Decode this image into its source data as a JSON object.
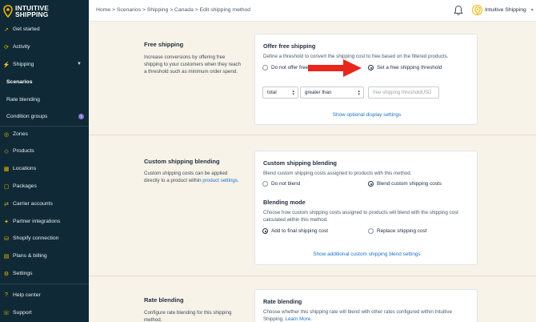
{
  "app": {
    "logo_line1": "INTUITIVE",
    "logo_line2": "SHIPPING"
  },
  "sidebar": {
    "items": [
      {
        "label": "Get started",
        "icon": "rocket-icon"
      },
      {
        "label": "Activity",
        "icon": "activity-icon"
      },
      {
        "label": "Shipping",
        "icon": "shipping-icon"
      },
      {
        "label": "Scenarios"
      },
      {
        "label": "Rate blending"
      },
      {
        "label": "Condition groups",
        "badge": "i"
      },
      {
        "label": "Zones",
        "icon": "zones-icon"
      },
      {
        "label": "Products",
        "icon": "products-icon"
      },
      {
        "label": "Locations",
        "icon": "locations-icon"
      },
      {
        "label": "Packages",
        "icon": "packages-icon"
      },
      {
        "label": "Carrier accounts",
        "icon": "carrier-icon"
      },
      {
        "label": "Partner integrations",
        "icon": "partner-icon"
      },
      {
        "label": "Shopify connection",
        "icon": "shopify-icon"
      },
      {
        "label": "Plans & billing",
        "icon": "billing-icon"
      },
      {
        "label": "Settings",
        "icon": "gear-icon"
      },
      {
        "label": "Help center",
        "icon": "help-icon"
      },
      {
        "label": "Support",
        "icon": "support-icon"
      }
    ]
  },
  "topbar": {
    "breadcrumb": "Home > Scenarios > Shipping > Canada > Edit shipping method",
    "user_name": "Intuitive Shipping"
  },
  "free_shipping": {
    "section_title": "Free shipping",
    "section_desc": "Increase conversions by offering free shipping to your customers when they reach a threshold such as minimum order spend.",
    "card_title": "Offer free shipping",
    "card_text": "Define a threshold to convert the shipping cost to free based on the filtered products.",
    "option_no": "Do not offer free",
    "option_yes": "Set a free shipping threshold",
    "select_1": "total",
    "select_2": "greater than",
    "threshold_placeholder": "free shipping threshold",
    "threshold_unit": "USD",
    "link": "Show optional display settings"
  },
  "custom_blending": {
    "section_title": "Custom shipping blending",
    "section_desc_1": "Custom shipping costs can be applied directly to a product within ",
    "section_desc_link": "product settings",
    "section_desc_2": ".",
    "card_title": "Custom shipping blending",
    "card_text": "Blend custom shipping costs assigned to products with this method.",
    "option_no": "Do not blend",
    "option_yes": "Blend custom shipping costs",
    "mode_title": "Blending mode",
    "mode_text": "Choose how custom shipping costs assigned to products will blend with the shipping cost calculated within this method.",
    "mode_add": "Add to final shipping cost",
    "mode_replace": "Replace shipping cost",
    "link": "Show additional custom shipping blend settings"
  },
  "rate_blending": {
    "section_title": "Rate blending",
    "section_desc": "Configure rate blending for this shipping method.",
    "card_title": "Rate blending",
    "card_text_1": "Choose whether this shipping rate will blend with other rates configured within Intuitive Shipping. ",
    "card_link": "Learn More."
  },
  "colors": {
    "sidebar_bg": "#0f2a36",
    "accent": "#f2b600",
    "link": "#1a73c9",
    "arrow": "#e8261b",
    "page_bg": "#f8f3e9"
  }
}
